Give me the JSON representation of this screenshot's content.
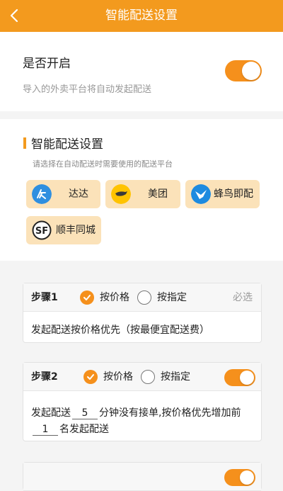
{
  "header": {
    "title": "智能配送设置",
    "back_icon": "chevron-left-icon"
  },
  "enable": {
    "label": "是否开启",
    "description": "导入的外卖平台将自动发起配送",
    "toggle_on": true
  },
  "platform_section": {
    "title": "智能配送设置",
    "subtitle": "请选择在自动配送时需要使用的配送平台",
    "platforms": [
      {
        "name": "达达",
        "icon": "dada-logo-icon",
        "color": "#2f8fe0"
      },
      {
        "name": "美团",
        "icon": "meituan-logo-icon",
        "color": "#ffc300"
      },
      {
        "name": "蜂鸟即配",
        "icon": "fengniao-logo-icon",
        "color": "#1e8be0"
      },
      {
        "name": "顺丰同城",
        "icon": "sf-logo-icon",
        "color": "#222222"
      }
    ]
  },
  "steps": [
    {
      "name": "步骤1",
      "option_price": "按价格",
      "option_assign": "按指定",
      "selected": "price",
      "required_label": "必选",
      "body": "发起配送按价格优先（按最便宜配送费）"
    },
    {
      "name": "步骤2",
      "option_price": "按价格",
      "option_assign": "按指定",
      "selected": "price",
      "toggle_on": true,
      "body_part1": "发起配送",
      "minutes": "5",
      "body_part2": "分钟没有接单,按价格优先增加前",
      "top_n": "1",
      "body_part3": "名发起配送"
    }
  ],
  "colors": {
    "accent": "#f39a1e",
    "platform_bg": "#fbe2b9"
  }
}
